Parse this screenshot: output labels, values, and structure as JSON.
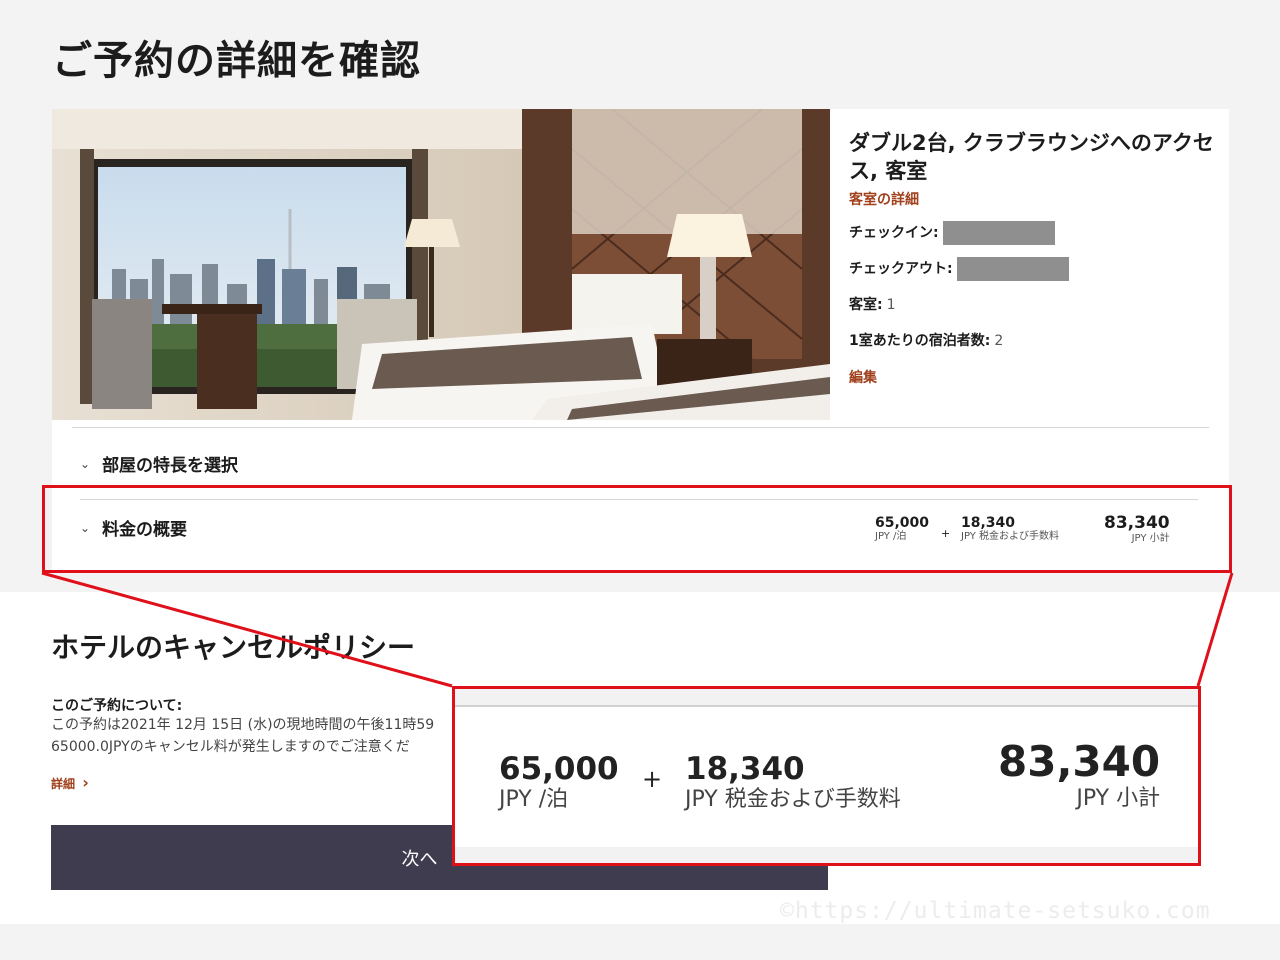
{
  "page": {
    "title": "ご予約の詳細を確認"
  },
  "room": {
    "name": "ダブル2台, クラブラウンジへのアクセス, 客室",
    "details_link": "客室の詳細",
    "checkin_label": "チェックイン:",
    "checkout_label": "チェックアウト:",
    "rooms_label": "客室:",
    "rooms_value": "1",
    "guests_label": "1室あたりの宿泊者数:",
    "guests_value": "2",
    "edit_link": "編集"
  },
  "accordion": {
    "features_label": "部屋の特長を選択",
    "summary_label": "料金の概要"
  },
  "price": {
    "per_night": "65,000",
    "per_night_label": "JPY /泊",
    "plus": "+",
    "taxes": "18,340",
    "taxes_label": "JPY 税金および手数料",
    "subtotal": "83,340",
    "subtotal_label": "JPY 小計"
  },
  "cancel_policy": {
    "title": "ホテルのキャンセルポリシー",
    "heading": "このご予約について:",
    "line1": "この予約は2021年 12月 15日 (水)の現地時間の午後11時59",
    "line2": "65000.0JPYのキャンセル料が発生しますのでご注意くだ",
    "details_link": "詳細",
    "details_chevron": "›"
  },
  "next_button": {
    "label": "次へ"
  },
  "watermark": "©https://ultimate-setsuko.com",
  "colors": {
    "accent": "#a0401c",
    "highlight": "#e0101a",
    "button": "#3f3c4f"
  }
}
